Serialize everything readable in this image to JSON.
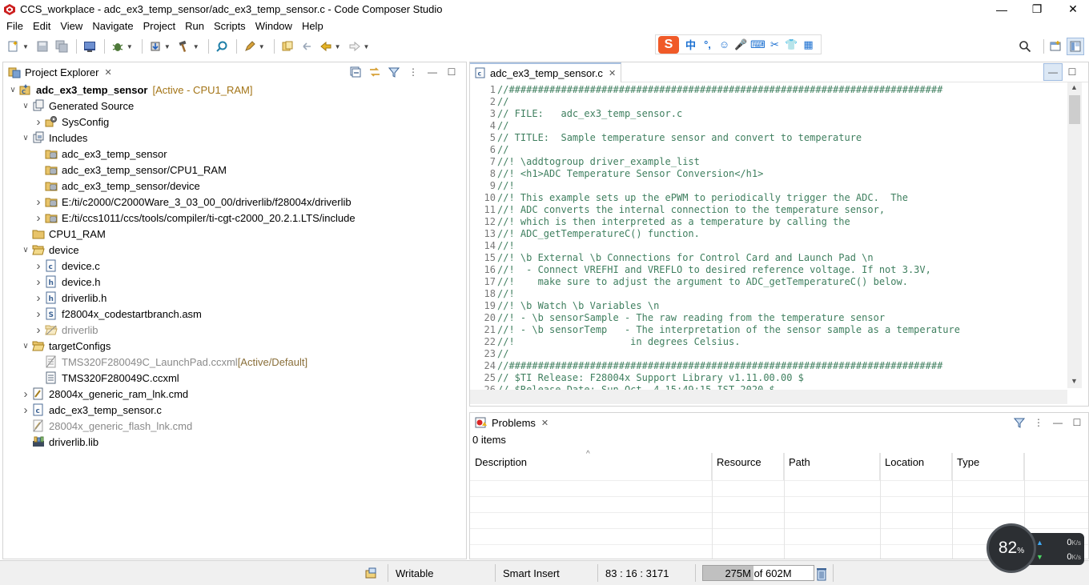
{
  "window": {
    "title": "CCS_workplace - adc_ex3_temp_sensor/adc_ex3_temp_sensor.c - Code Composer Studio",
    "minimize": "—",
    "restore": "❐",
    "close": "✕"
  },
  "menu": [
    "File",
    "Edit",
    "View",
    "Navigate",
    "Project",
    "Run",
    "Scripts",
    "Window",
    "Help"
  ],
  "ime": {
    "logo": "S",
    "items": [
      "中",
      "°,",
      "☺",
      "🎤",
      "⌨",
      "✂",
      "👕",
      "▦"
    ]
  },
  "project_explorer": {
    "tab_label": "Project Explorer",
    "tree": [
      {
        "label": "adc_ex3_temp_sensor",
        "decor": "[Active - CPU1_RAM]",
        "level": 0,
        "twisty": "open",
        "icon": "project-icon",
        "bold": true
      },
      {
        "label": "Generated Source",
        "level": 1,
        "twisty": "open",
        "icon": "generated-source-icon"
      },
      {
        "label": "SysConfig",
        "level": 2,
        "twisty": "closed",
        "icon": "sysconfig-icon"
      },
      {
        "label": "Includes",
        "level": 1,
        "twisty": "open",
        "icon": "includes-icon"
      },
      {
        "label": "adc_ex3_temp_sensor",
        "level": 2,
        "twisty": "none",
        "icon": "include-folder-icon"
      },
      {
        "label": "adc_ex3_temp_sensor/CPU1_RAM",
        "level": 2,
        "twisty": "none",
        "icon": "include-folder-icon"
      },
      {
        "label": "adc_ex3_temp_sensor/device",
        "level": 2,
        "twisty": "none",
        "icon": "include-folder-icon"
      },
      {
        "label": "E:/ti/c2000/C2000Ware_3_03_00_00/driverlib/f28004x/driverlib",
        "level": 2,
        "twisty": "closed",
        "icon": "include-folder-icon"
      },
      {
        "label": "E:/ti/ccs1011/ccs/tools/compiler/ti-cgt-c2000_20.2.1.LTS/include",
        "level": 2,
        "twisty": "closed",
        "icon": "include-folder-icon"
      },
      {
        "label": "CPU1_RAM",
        "level": 1,
        "twisty": "none",
        "icon": "folder-icon"
      },
      {
        "label": "device",
        "level": 1,
        "twisty": "open",
        "icon": "folder-open-icon"
      },
      {
        "label": "device.c",
        "level": 2,
        "twisty": "closed",
        "icon": "c-file-icon"
      },
      {
        "label": "device.h",
        "level": 2,
        "twisty": "closed",
        "icon": "h-file-icon"
      },
      {
        "label": "driverlib.h",
        "level": 2,
        "twisty": "closed",
        "icon": "h-file-icon"
      },
      {
        "label": "f28004x_codestartbranch.asm",
        "level": 2,
        "twisty": "closed",
        "icon": "asm-file-icon"
      },
      {
        "label": "driverlib",
        "level": 2,
        "twisty": "closed",
        "icon": "excluded-folder-icon",
        "dim": true
      },
      {
        "label": "targetConfigs",
        "level": 1,
        "twisty": "open",
        "icon": "folder-open-icon"
      },
      {
        "label": "TMS320F280049C_LaunchPad.ccxml",
        "decor": "[Active/Default]",
        "level": 2,
        "twisty": "none",
        "icon": "excluded-ccxml-icon",
        "dim": true
      },
      {
        "label": "TMS320F280049C.ccxml",
        "level": 2,
        "twisty": "none",
        "icon": "ccxml-file-icon"
      },
      {
        "label": "28004x_generic_ram_lnk.cmd",
        "level": 1,
        "twisty": "closed",
        "icon": "cmd-file-icon"
      },
      {
        "label": "adc_ex3_temp_sensor.c",
        "level": 1,
        "twisty": "closed",
        "icon": "c-file-icon"
      },
      {
        "label": "28004x_generic_flash_lnk.cmd",
        "level": 1,
        "twisty": "none",
        "icon": "excluded-cmd-icon",
        "dim": true
      },
      {
        "label": "driverlib.lib",
        "level": 1,
        "twisty": "none",
        "icon": "library-icon"
      }
    ]
  },
  "editor": {
    "tab_label": "adc_ex3_temp_sensor.c",
    "lines": [
      {
        "num": "1",
        "text": "//###########################################################################"
      },
      {
        "num": "2",
        "text": "//"
      },
      {
        "num": "3",
        "text": "// FILE:   adc_ex3_temp_sensor.c"
      },
      {
        "num": "4",
        "text": "//"
      },
      {
        "num": "5",
        "text": "// TITLE:  Sample temperature sensor and convert to temperature"
      },
      {
        "num": "6",
        "text": "//"
      },
      {
        "num": "7",
        "text": "//! \\addtogroup driver_example_list"
      },
      {
        "num": "8",
        "text": "//! <h1>ADC Temperature Sensor Conversion</h1>"
      },
      {
        "num": "9",
        "text": "//!"
      },
      {
        "num": "10",
        "text": "//! This example sets up the ePWM to periodically trigger the ADC.  The"
      },
      {
        "num": "11",
        "text": "//! ADC converts the internal connection to the temperature sensor,"
      },
      {
        "num": "12",
        "text": "//! which is then interpreted as a temperature by calling the"
      },
      {
        "num": "13",
        "text": "//! ADC_getTemperatureC() function."
      },
      {
        "num": "14",
        "text": "//!"
      },
      {
        "num": "15",
        "text": "//! \\b External \\b Connections for Control Card and Launch Pad \\n"
      },
      {
        "num": "16",
        "text": "//!  - Connect VREFHI and VREFLO to desired reference voltage. If not 3.3V,"
      },
      {
        "num": "17",
        "text": "//!    make sure to adjust the argument to ADC_getTemperatureC() below."
      },
      {
        "num": "18",
        "text": "//!"
      },
      {
        "num": "19",
        "text": "//! \\b Watch \\b Variables \\n"
      },
      {
        "num": "20",
        "text": "//! - \\b sensorSample - The raw reading from the temperature sensor"
      },
      {
        "num": "21",
        "text": "//! - \\b sensorTemp   - The interpretation of the sensor sample as a temperature"
      },
      {
        "num": "22",
        "text": "//!                    in degrees Celsius."
      },
      {
        "num": "23",
        "text": "//"
      },
      {
        "num": "24",
        "text": "//###########################################################################"
      },
      {
        "num": "25",
        "text": "// $TI Release: F28004x Support Library v1.11.00.00 $"
      },
      {
        "num": "26",
        "text": "// $Release Date: Sun Oct  4 15:49:15 IST 2020 $"
      }
    ]
  },
  "problems": {
    "tab_label": "Problems",
    "count": "0 items",
    "columns": [
      "Description",
      "Resource",
      "Path",
      "Location",
      "Type"
    ]
  },
  "status": {
    "writable": "Writable",
    "insert_mode": "Smart Insert",
    "position": "83 : 16 : 3171",
    "heap_text": "275M of 602M",
    "heap_used_fraction": 0.457
  },
  "net": {
    "percent": "82",
    "percent_unit": "%",
    "up": "0",
    "down": "0",
    "unit": "K/s"
  },
  "colors": {
    "comment": "#3f7f5f",
    "line_number": "#787878",
    "decoration": "#a37416"
  }
}
